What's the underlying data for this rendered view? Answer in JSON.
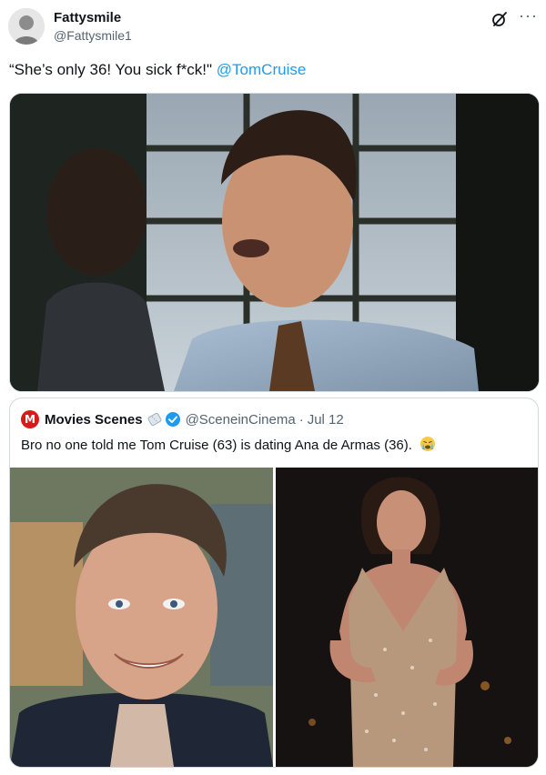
{
  "author": {
    "display_name": "Fattysmile",
    "handle": "@Fattysmile1"
  },
  "tweet": {
    "text_prefix": "“She’s only 36! You sick f*ck!\" ",
    "mention": "@TomCruise"
  },
  "icons": {
    "grok": "grok-icon",
    "more": "more-icon",
    "verified": "verified-badge-icon",
    "ticket": "ticket-icon",
    "emoji": "crying-face-emoji"
  },
  "quoted": {
    "logo_letter": "M",
    "display_name": "Movies Scenes",
    "handle": "@SceneinCinema",
    "separator": "·",
    "date": "Jul 12",
    "text": "Bro no one told me Tom Cruise (63) is dating Ana de Armas (36)."
  },
  "colors": {
    "accent": "#1d9bf0",
    "muted": "#536471",
    "brand_logo": "#d71a1a"
  }
}
